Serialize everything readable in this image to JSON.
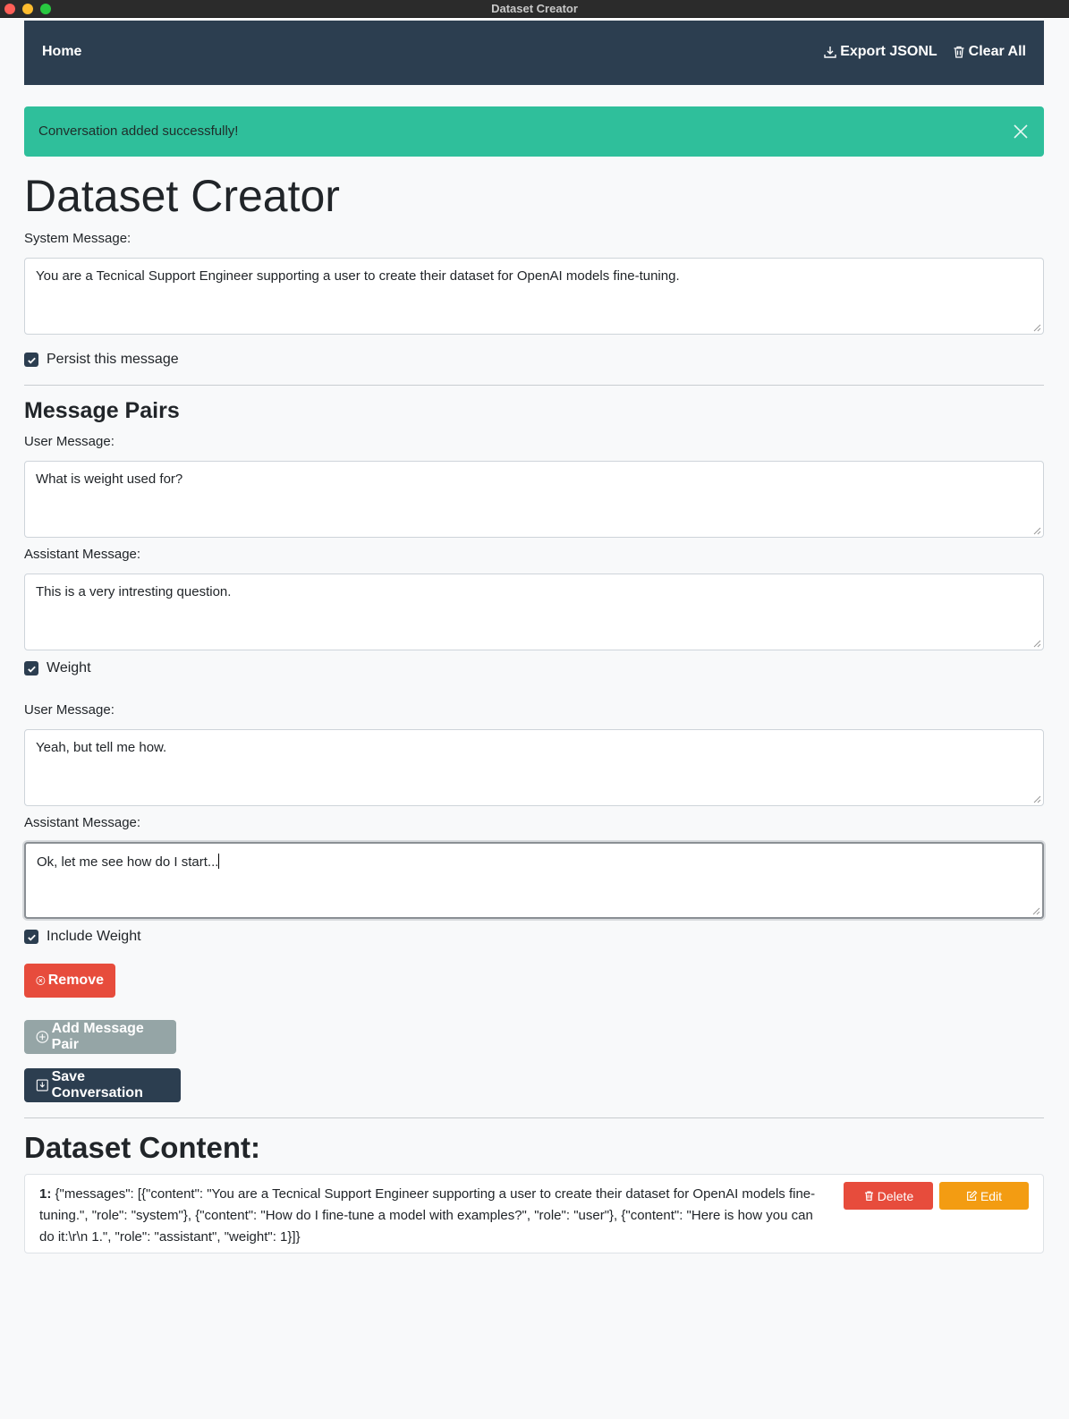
{
  "window": {
    "title": "Dataset Creator"
  },
  "navbar": {
    "home": "Home",
    "export_label": "Export JSONL",
    "clear_label": "Clear All"
  },
  "alert": {
    "message": "Conversation added successfully!"
  },
  "page": {
    "title": "Dataset Creator"
  },
  "system": {
    "label": "System Message:",
    "value": "You are a Tecnical Support Engineer supporting a user to create their dataset for OpenAI models fine-tuning.",
    "persist_label": "Persist this message",
    "persist_checked": true
  },
  "pairs": {
    "heading": "Message Pairs",
    "items": [
      {
        "user_label": "User Message:",
        "user_value": "What is weight used for?",
        "assistant_label": "Assistant Message:",
        "assistant_value": "This is a very intresting question.",
        "weight_label": "Weight",
        "weight_checked": true
      },
      {
        "user_label": "User Message:",
        "user_value": "Yeah, but tell me how.",
        "assistant_label": "Assistant Message:",
        "assistant_value": "Ok, let me see how do I start...",
        "weight_label": "Include Weight",
        "weight_checked": true
      }
    ],
    "remove_label": "Remove"
  },
  "actions": {
    "add_pair_label": "Add Message Pair",
    "save_label": "Save Conversation"
  },
  "dataset": {
    "heading": "Dataset Content:",
    "records": [
      {
        "index": "1:",
        "text": " {\"messages\": [{\"content\": \"You are a Tecnical Support Engineer supporting a user to create their dataset for OpenAI models fine-tuning.\", \"role\": \"system\"}, {\"content\": \"How do I fine-tune a model with examples?\", \"role\": \"user\"}, {\"content\": \"Here is how you can do it:\\r\\n 1.\", \"role\": \"assistant\", \"weight\": 1}]}",
        "delete_label": "Delete",
        "edit_label": "Edit"
      }
    ]
  },
  "colors": {
    "navbar": "#2c3e50",
    "alert": "#2fbf9b",
    "danger": "#e74c3c",
    "warning": "#f39c12",
    "secondary": "#95a5a6"
  }
}
